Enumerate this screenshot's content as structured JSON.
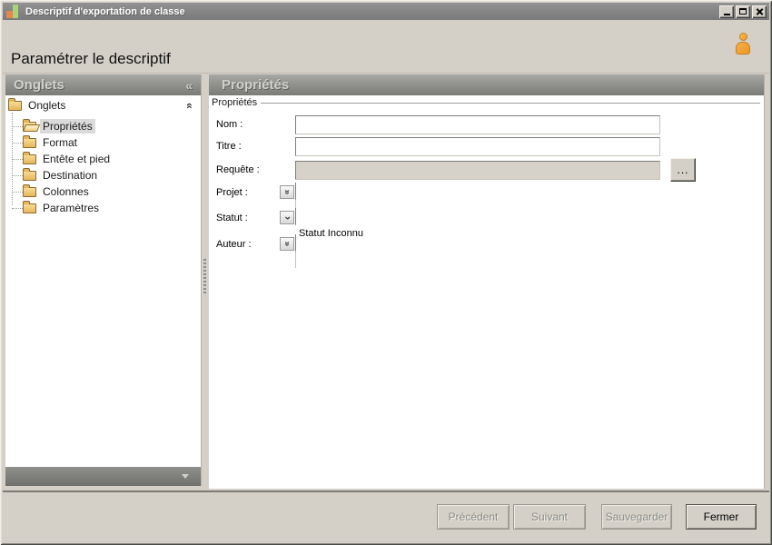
{
  "window": {
    "title": "Descriptif d'exportation de classe"
  },
  "header": {
    "title": "Paramétrer le descriptif"
  },
  "sidebar": {
    "header": {
      "title": "Onglets",
      "collapse_glyph": "«"
    },
    "tree": {
      "root_label": "Onglets",
      "collapse_glyph": "«",
      "items": [
        {
          "label": "Propriétés",
          "selected": true
        },
        {
          "label": "Format",
          "selected": false
        },
        {
          "label": "Entête et pied",
          "selected": false
        },
        {
          "label": "Destination",
          "selected": false
        },
        {
          "label": "Colonnes",
          "selected": false
        },
        {
          "label": "Paramètres",
          "selected": false
        }
      ]
    }
  },
  "main": {
    "header": {
      "title": "Propriétés"
    },
    "group_legend": "Propriétés",
    "fields": {
      "nom": {
        "label": "Nom :",
        "value": ""
      },
      "titre": {
        "label": "Titre :",
        "value": ""
      },
      "requete": {
        "label": "Requête :",
        "value": "",
        "browse_label": "..."
      },
      "projet": {
        "label": "Projet :",
        "value": ""
      },
      "statut": {
        "label": "Statut :",
        "value": "Statut Inconnu"
      },
      "auteur": {
        "label": "Auteur :",
        "value": ""
      }
    }
  },
  "footer": {
    "buttons": [
      {
        "label": "Précédent",
        "enabled": false
      },
      {
        "label": "Suivant",
        "enabled": false
      },
      {
        "label": "Sauvegarder",
        "enabled": false
      },
      {
        "label": "Fermer",
        "enabled": true
      }
    ]
  },
  "glyphs": {
    "chevron_double": "«",
    "chevron_single": "‹"
  }
}
